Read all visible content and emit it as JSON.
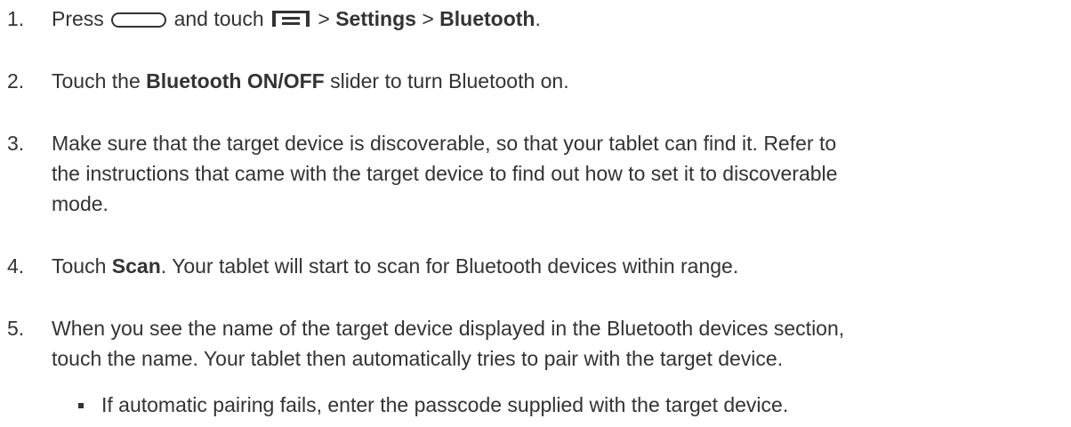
{
  "steps": [
    {
      "number": "1.",
      "parts": {
        "a": "Press",
        "b": "and touch",
        "c": ">",
        "d": "Settings",
        "e": ">",
        "f": "Bluetooth",
        "g": "."
      }
    },
    {
      "number": "2.",
      "parts": {
        "a": "Touch the",
        "b": "Bluetooth ON/OFF",
        "c": "slider to turn Bluetooth on."
      }
    },
    {
      "number": "3.",
      "line1": "Make sure that the target device is discoverable, so that your tablet can find it. Refer to",
      "line2": "the instructions that came with the target device to find out how to set it to discoverable",
      "line3": "mode."
    },
    {
      "number": "4.",
      "parts": {
        "a": "Touch",
        "b": "Scan",
        "c": ". Your tablet will start to scan for Bluetooth devices within range."
      }
    },
    {
      "number": "5.",
      "line1": "When you see the name of the target device displayed in the Bluetooth devices section,",
      "line2": "touch the name. Your tablet then automatically tries to pair with the target device."
    }
  ],
  "bullet": {
    "text": "If automatic pairing fails, enter the passcode supplied with the target device."
  },
  "icons": {
    "home_key": "home-key-icon",
    "menu_key": "menu-key-icon"
  }
}
